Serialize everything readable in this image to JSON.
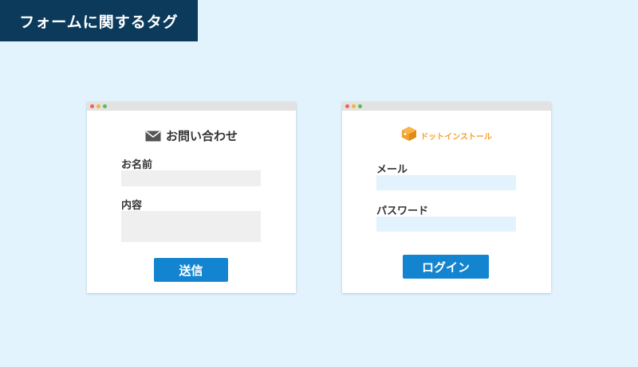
{
  "page_title": "フォームに関するタグ",
  "colors": {
    "background": "#e2f3fe",
    "title_bg": "#0b3a5b",
    "button_blue": "#1384cf",
    "logo_orange": "#f4a12c",
    "input_gray": "#efefef",
    "input_blue": "#e2f3fe"
  },
  "contact_form": {
    "title": "お問い合わせ",
    "icon": "mail-icon",
    "name_label": "お名前",
    "content_label": "内容",
    "submit_label": "送信"
  },
  "login_form": {
    "logo_text": "ドットインストール",
    "logo_icon": "box-icon",
    "email_label": "メール",
    "password_label": "パスワード",
    "login_label": "ログイン"
  }
}
